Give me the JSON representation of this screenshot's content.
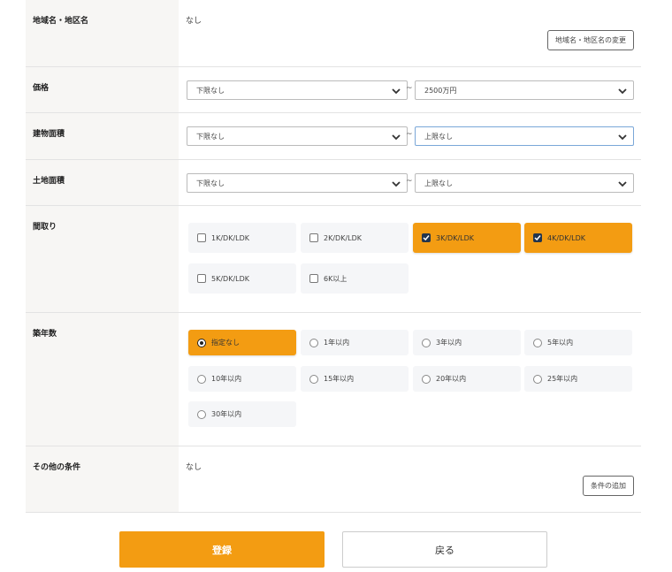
{
  "area": {
    "label": "地域名・地区名",
    "value": "なし",
    "change_button": "地域名・地区名の変更"
  },
  "price": {
    "label": "価格",
    "min": "下限なし",
    "max": "2500万円",
    "separator": "~"
  },
  "building_area": {
    "label": "建物面積",
    "min": "下限なし",
    "max": "上限なし",
    "separator": "~"
  },
  "land_area": {
    "label": "土地面積",
    "min": "下限なし",
    "max": "上限なし",
    "separator": "~"
  },
  "layout": {
    "label": "間取り",
    "options": [
      {
        "label": "1K/DK/LDK",
        "checked": false
      },
      {
        "label": "2K/DK/LDK",
        "checked": false
      },
      {
        "label": "3K/DK/LDK",
        "checked": true
      },
      {
        "label": "4K/DK/LDK",
        "checked": true
      },
      {
        "label": "5K/DK/LDK",
        "checked": false
      },
      {
        "label": "6K以上",
        "checked": false
      }
    ]
  },
  "age": {
    "label": "築年数",
    "options": [
      {
        "label": "指定なし",
        "selected": true
      },
      {
        "label": "1年以内",
        "selected": false
      },
      {
        "label": "3年以内",
        "selected": false
      },
      {
        "label": "5年以内",
        "selected": false
      },
      {
        "label": "10年以内",
        "selected": false
      },
      {
        "label": "15年以内",
        "selected": false
      },
      {
        "label": "20年以内",
        "selected": false
      },
      {
        "label": "25年以内",
        "selected": false
      },
      {
        "label": "30年以内",
        "selected": false
      }
    ]
  },
  "other": {
    "label": "その他の条件",
    "value": "なし",
    "add_button": "条件の追加"
  },
  "actions": {
    "submit": "登録",
    "back": "戻る"
  },
  "colors": {
    "accent": "#f39c12",
    "checkbox_fill": "#23354d",
    "label_bg": "#f7f6f4"
  }
}
